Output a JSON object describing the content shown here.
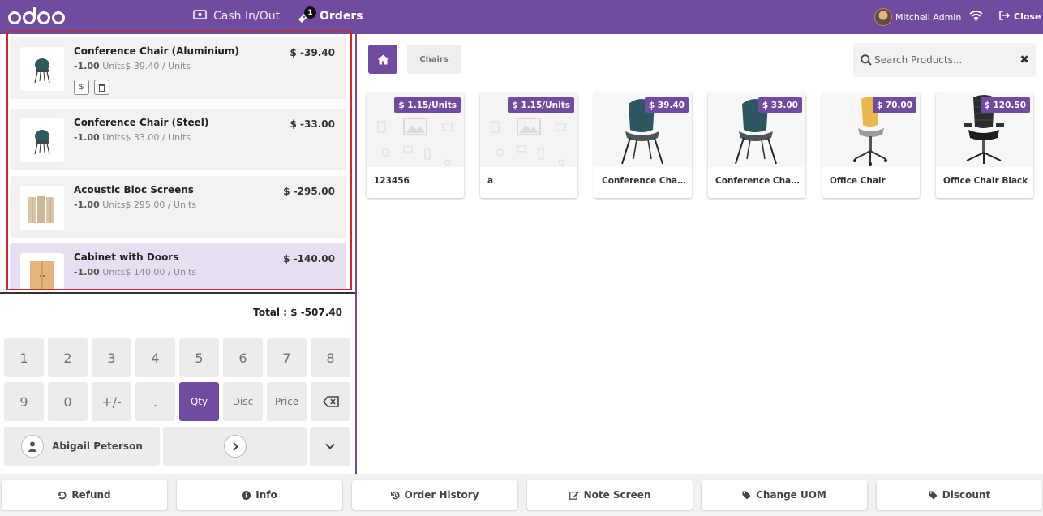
{
  "header": {
    "logo_text": "odoo",
    "cash_label": "Cash In/Out",
    "orders_label": "Orders",
    "orders_count": "1",
    "user_name": "Mitchell Admin",
    "close_label": "Close"
  },
  "orderlines": [
    {
      "name": "Conference Chair (Aluminium)",
      "price": "$ -39.40",
      "qty": "-1.00",
      "unit_info": "Units$ 39.40 / Units"
    },
    {
      "name": "Conference Chair (Steel)",
      "price": "$ -33.00",
      "qty": "-1.00",
      "unit_info": "Units$ 33.00 / Units"
    },
    {
      "name": "Acoustic Bloc Screens",
      "price": "$ -295.00",
      "qty": "-1.00",
      "unit_info": "Units$ 295.00 / Units"
    },
    {
      "name": "Cabinet with Doors",
      "price": "$ -140.00",
      "qty": "-1.00",
      "unit_info": "Units$ 140.00 / Units"
    }
  ],
  "total": "Total : $ -507.40",
  "numpad": {
    "row1": [
      "1",
      "2",
      "3",
      "4",
      "5",
      "6",
      "7",
      "8"
    ],
    "row2": [
      "9",
      "0",
      "+/-",
      ".",
      "Qty",
      "Disc",
      "Price"
    ],
    "customer": "Abigail Peterson"
  },
  "category": "Chairs",
  "search": {
    "placeholder": "Search Products..."
  },
  "products": [
    {
      "name": "123456",
      "price": "$ 1.15/Units"
    },
    {
      "name": "a",
      "price": "$ 1.15/Units"
    },
    {
      "name": "Conference Chair (Aluminium)",
      "price": "$ 39.40"
    },
    {
      "name": "Conference Chair (Steel)",
      "price": "$ 33.00"
    },
    {
      "name": "Office Chair",
      "price": "$ 70.00"
    },
    {
      "name": "Office Chair Black",
      "price": "$ 120.50"
    }
  ],
  "control_buttons": [
    "Refund",
    "Info",
    "Order History",
    "Note Screen",
    "Change UOM",
    "Discount"
  ],
  "colors": {
    "brand": "#714b9f",
    "highlight_border": "#d02828"
  }
}
